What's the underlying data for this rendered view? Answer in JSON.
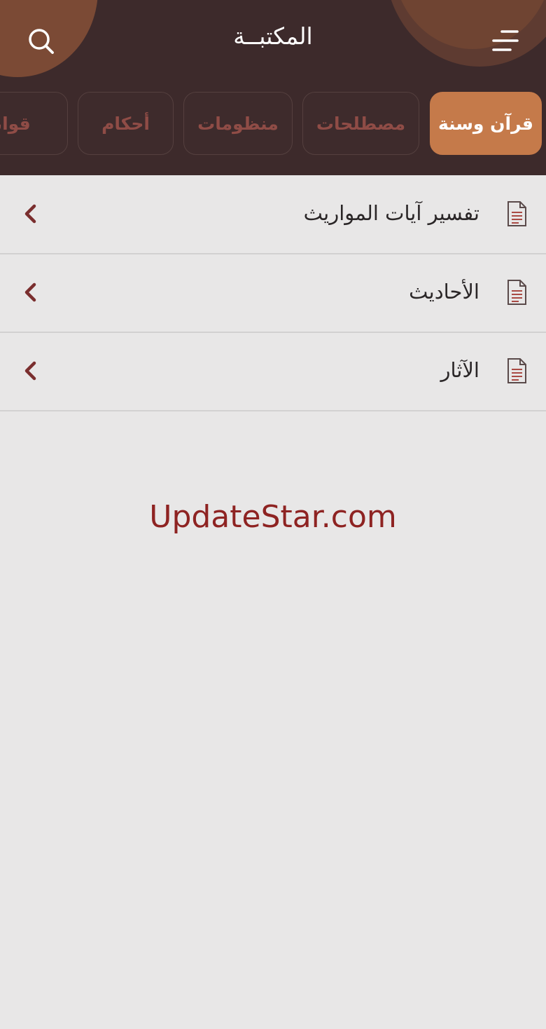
{
  "header": {
    "title": "المكتبــة",
    "menu_icon": "menu-icon",
    "search_icon": "search-icon"
  },
  "tabs": [
    {
      "label": "قرآن وسنة",
      "active": true
    },
    {
      "label": "مصطلحات",
      "active": false
    },
    {
      "label": "منظومات",
      "active": false
    },
    {
      "label": "أحكام",
      "active": false
    },
    {
      "label": "قوانين",
      "active": false
    }
  ],
  "list": {
    "items": [
      {
        "label": "تفسير آيات المواريث",
        "icon": "document-icon",
        "arrow": "chevron-left-icon"
      },
      {
        "label": "الأحاديث",
        "icon": "document-icon",
        "arrow": "chevron-left-icon"
      },
      {
        "label": "الآثار",
        "icon": "document-icon",
        "arrow": "chevron-left-icon"
      }
    ]
  },
  "watermark": {
    "text": "UpdateStar.com"
  },
  "colors": {
    "header_bg": "#3d2a2b",
    "accent": "#c57a4a",
    "tab_text": "#8f4c46",
    "body_bg": "#e8e7e7",
    "chevron": "#7a2e2e",
    "watermark": "#8e2322"
  }
}
